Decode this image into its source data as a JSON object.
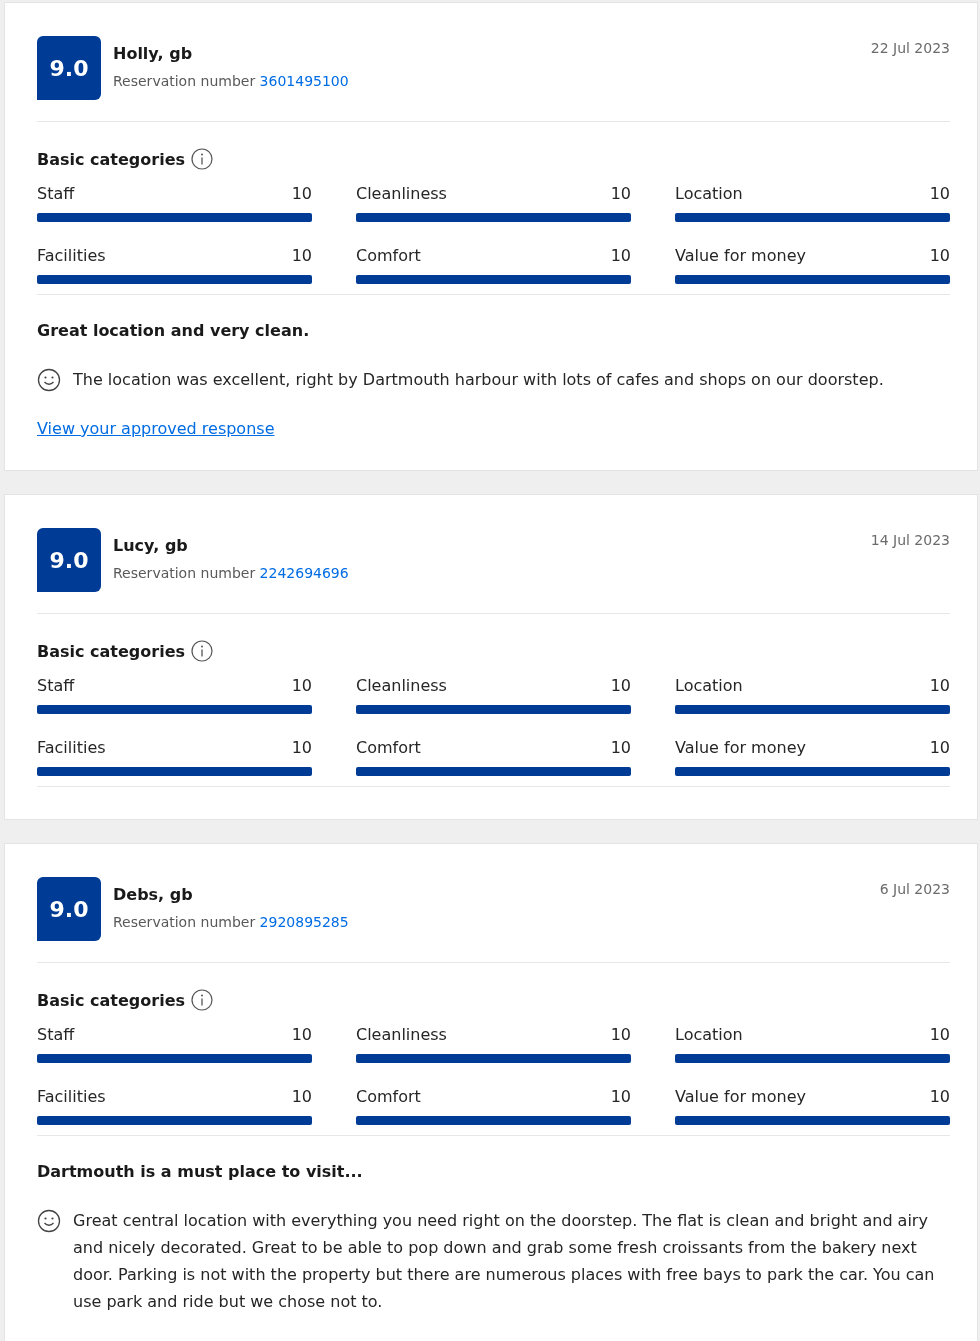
{
  "reviews": [
    {
      "score": "9.0",
      "name": "Holly, gb",
      "reservation_label": "Reservation number",
      "reservation_number": "3601495100",
      "date": "22 Jul 2023",
      "categories_title": "Basic categories",
      "categories": [
        {
          "label": "Staff",
          "score": "10",
          "level": 1
        },
        {
          "label": "Cleanliness",
          "score": "10",
          "level": 1
        },
        {
          "label": "Location",
          "score": "10",
          "level": 1
        },
        {
          "label": "Facilities",
          "score": "10",
          "level": 1
        },
        {
          "label": "Comfort",
          "score": "10",
          "level": 1
        },
        {
          "label": "Value for money",
          "score": "10",
          "level": 1
        }
      ],
      "review_title": "Great location and very clean.",
      "review_text": "The location was excellent, right by Dartmouth harbour with lots of cafes and shops on our doorstep.",
      "link": "View your approved response"
    },
    {
      "score": "9.0",
      "name": "Lucy, gb",
      "reservation_label": "Reservation number",
      "reservation_number": "2242694696",
      "date": "14 Jul 2023",
      "categories_title": "Basic categories",
      "categories": [
        {
          "label": "Staff",
          "score": "10",
          "level": 1
        },
        {
          "label": "Cleanliness",
          "score": "10",
          "level": 1
        },
        {
          "label": "Location",
          "score": "10",
          "level": 1
        },
        {
          "label": "Facilities",
          "score": "10",
          "level": 1
        },
        {
          "label": "Comfort",
          "score": "10",
          "level": 1
        },
        {
          "label": "Value for money",
          "score": "10",
          "level": 1
        }
      ]
    },
    {
      "score": "9.0",
      "name": "Debs, gb",
      "reservation_label": "Reservation number",
      "reservation_number": "2920895285",
      "date": "6 Jul 2023",
      "categories_title": "Basic categories",
      "categories": [
        {
          "label": "Staff",
          "score": "10",
          "level": 1
        },
        {
          "label": "Cleanliness",
          "score": "10",
          "level": 1
        },
        {
          "label": "Location",
          "score": "10",
          "level": 1
        },
        {
          "label": "Facilities",
          "score": "10",
          "level": 1
        },
        {
          "label": "Comfort",
          "score": "10",
          "level": 1
        },
        {
          "label": "Value for money",
          "score": "10",
          "level": 1
        }
      ],
      "review_title": "Dartmouth is a must place to visit...",
      "review_text": "Great central location with everything you need right on the doorstep. The flat is clean and bright and airy and nicely decorated. Great to be able to pop down and grab some fresh croissants from the bakery next door. Parking is not with the property but there are numerous places with free bays to park the car. You can use park and ride but we chose not to."
    }
  ]
}
